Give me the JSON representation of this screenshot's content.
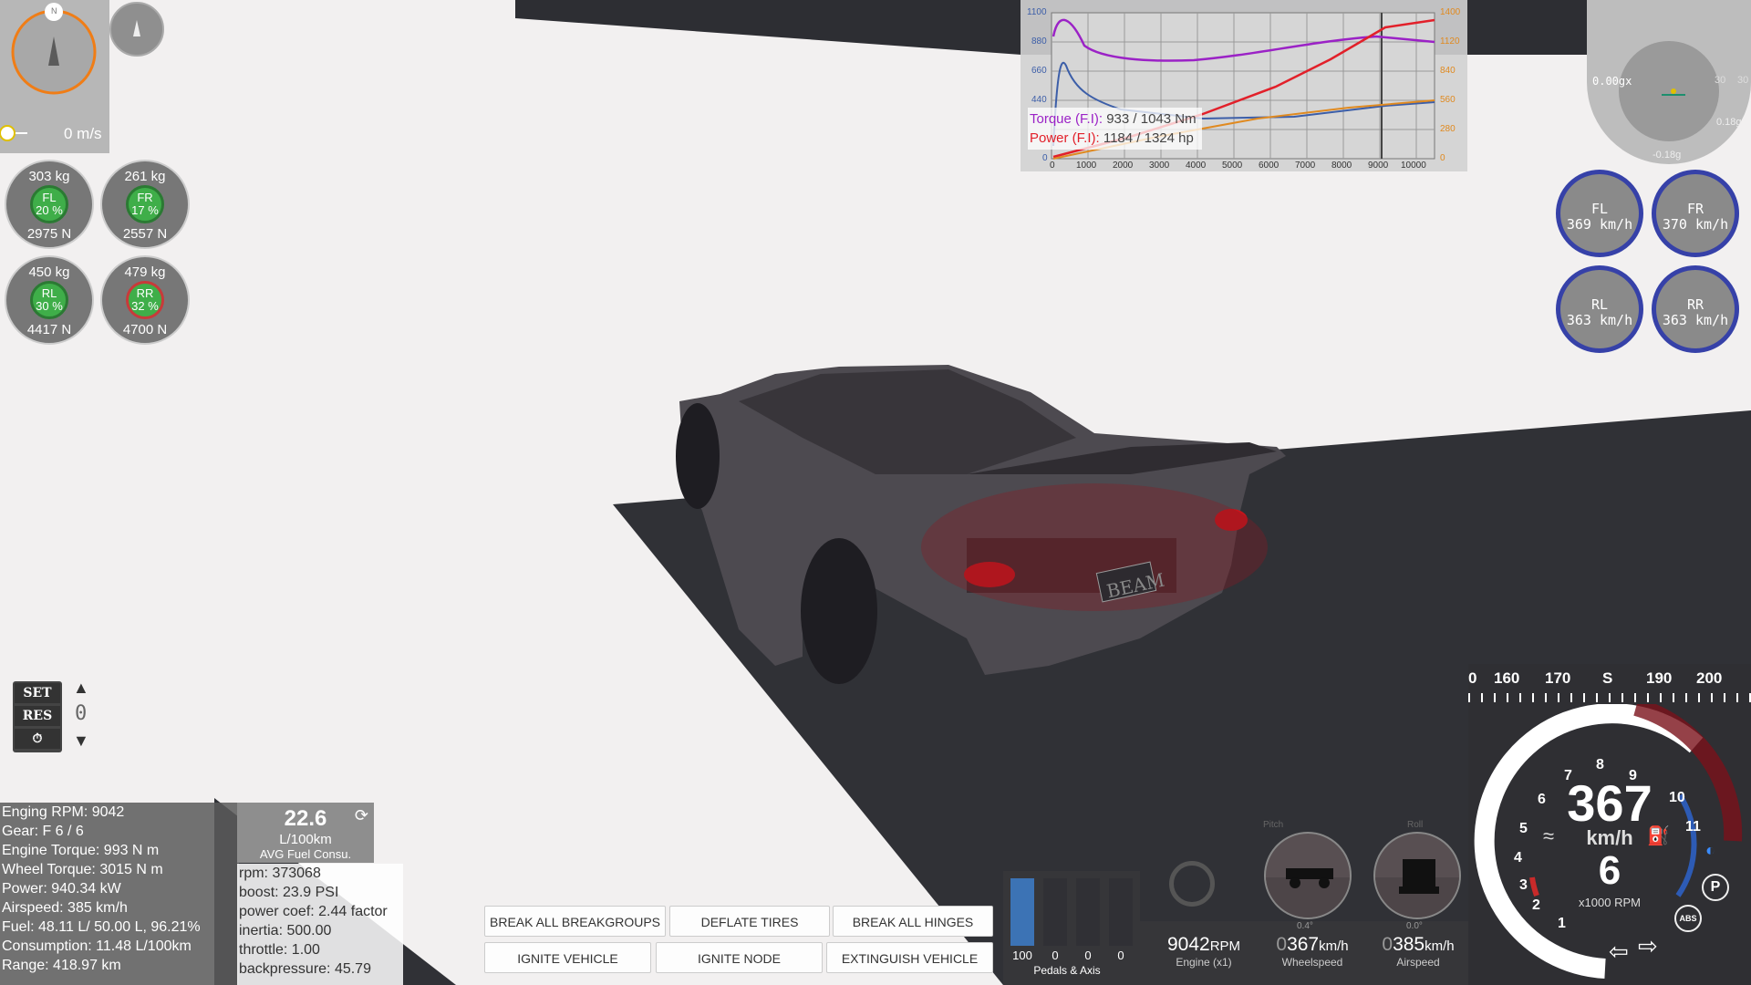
{
  "compass": {
    "north_label": "N",
    "speed": "0 m/s"
  },
  "tires": [
    {
      "id": "FL",
      "mass": "303  kg",
      "pct": "20 %",
      "force": "2975  N"
    },
    {
      "id": "FR",
      "mass": "261  kg",
      "pct": "17 %",
      "force": "2557  N"
    },
    {
      "id": "RL",
      "mass": "450  kg",
      "pct": "30 %",
      "force": "4417  N"
    },
    {
      "id": "RR",
      "mass": "479  kg",
      "pct": "32 %",
      "force": "4700  N"
    }
  ],
  "graph": {
    "torque_label": "Torque (F.I):",
    "torque_value": "933 / 1043 Nm",
    "power_label": "Power (F.I):",
    "power_value": "1184 / 1324 hp",
    "left_ticks": [
      "1100",
      "880",
      "660",
      "440",
      "0"
    ],
    "right_ticks": [
      "1400",
      "1120",
      "840",
      "560",
      "280",
      "0"
    ],
    "x_ticks": [
      "0",
      "1000",
      "2000",
      "3000",
      "4000",
      "5000",
      "6000",
      "7000",
      "8000",
      "9000",
      "10000"
    ],
    "colors": {
      "torque": "#9b22c6",
      "power": "#e2202a",
      "boost": "#e08a20",
      "blue": "#3c5ea8"
    }
  },
  "gforce": {
    "value": "0.00gx",
    "a": "0.18g",
    "b": "-0.18g",
    "c": "30",
    "d": "30"
  },
  "wheel_speeds": [
    {
      "id": "FL",
      "speed": "369  km/h"
    },
    {
      "id": "FR",
      "speed": "370  km/h"
    },
    {
      "id": "RL",
      "speed": "363  km/h"
    },
    {
      "id": "RR",
      "speed": "363  km/h"
    }
  ],
  "cruise": {
    "set": "SET",
    "res": "RES",
    "value": "0"
  },
  "info_lines": [
    "Enging RPM: 9042",
    "Gear: F 6 / 6",
    "Engine Torque: 993 N m",
    "Wheel Torque: 3015 N m",
    "Power: 940.34 kW",
    "Airspeed: 385 km/h",
    "Fuel: 48.11 L/ 50.00 L, 96.21%",
    "Consumption: 11.48 L/100km",
    "Range: 418.97 km"
  ],
  "fuel": {
    "value": "22.6",
    "unit": "L/100km",
    "label": "AVG Fuel Consu."
  },
  "debug_lines": [
    "rpm: 373068",
    "boost: 23.9 PSI",
    "power coef: 2.44 factor",
    "inertia: 500.00",
    "throttle: 1.00",
    "backpressure: 45.79"
  ],
  "buttons": {
    "break_groups": "BREAK ALL BREAKGROUPS",
    "deflate": "DEFLATE TIRES",
    "break_hinges": "BREAK ALL HINGES",
    "ignite_vehicle": "IGNITE VEHICLE",
    "ignite_node": "IGNITE NODE",
    "extinguish": "EXTINGUISH VEHICLE"
  },
  "pedals": {
    "values": [
      "100",
      "0",
      "0",
      "0"
    ],
    "fill": [
      1.0,
      0,
      0,
      0
    ],
    "label": "Pedals & Axis"
  },
  "attitude": {
    "pitch": "Pitch",
    "roll": "Roll",
    "pitch_val": "0.4°",
    "roll_val": "0.0°"
  },
  "readouts": {
    "rpm_value": "9042",
    "rpm_unit": "RPM",
    "rpm_label": "Engine (x1)",
    "wheel_prefix": "0",
    "wheel_value": "367",
    "wheel_unit": "km/h",
    "wheel_label": "Wheelspeed",
    "air_prefix": "0",
    "air_value": "385",
    "air_unit": "km/h",
    "air_label": "Airspeed"
  },
  "heading_strip": [
    "0",
    "160",
    "170",
    "S",
    "190",
    "200"
  ],
  "speedo": {
    "speed": "367",
    "unit": "km/h",
    "gear": "6",
    "rpm_label": "x1000 RPM",
    "ticks": [
      "1",
      "2",
      "3",
      "4",
      "5",
      "6",
      "7",
      "8",
      "9",
      "10",
      "11"
    ],
    "park": "P",
    "abs": "ABS"
  },
  "plate": "BEAM"
}
